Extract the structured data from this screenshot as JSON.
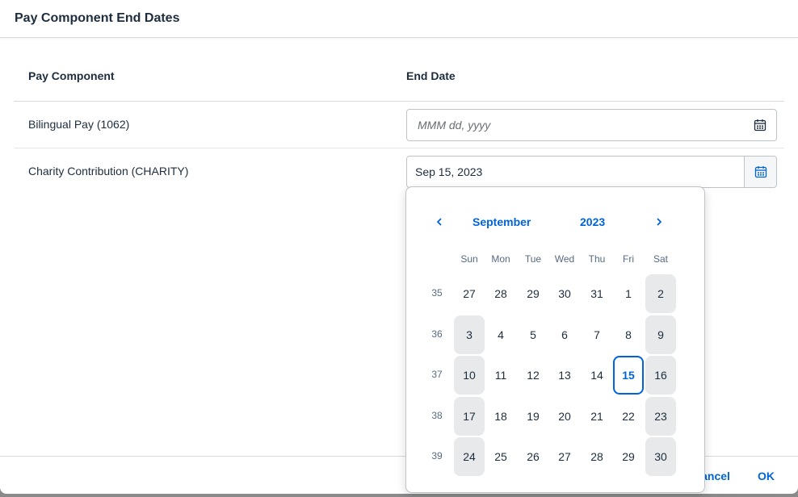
{
  "dialog": {
    "title": "Pay Component End Dates"
  },
  "table": {
    "col_pay_component": "Pay Component",
    "col_end_date": "End Date",
    "rows": [
      {
        "label": "Bilingual Pay (1062)",
        "value": "",
        "placeholder": "MMM dd, yyyy"
      },
      {
        "label": "Charity Contribution (CHARITY)",
        "value": "Sep 15, 2023",
        "placeholder": ""
      }
    ]
  },
  "calendar": {
    "month": "September",
    "year": "2023",
    "weekdays": [
      "Sun",
      "Mon",
      "Tue",
      "Wed",
      "Thu",
      "Fri",
      "Sat"
    ],
    "weeks": [
      {
        "week": "35",
        "days": [
          "27",
          "28",
          "29",
          "30",
          "31",
          "1",
          "2"
        ]
      },
      {
        "week": "36",
        "days": [
          "3",
          "4",
          "5",
          "6",
          "7",
          "8",
          "9"
        ]
      },
      {
        "week": "37",
        "days": [
          "10",
          "11",
          "12",
          "13",
          "14",
          "15",
          "16"
        ]
      },
      {
        "week": "38",
        "days": [
          "17",
          "18",
          "19",
          "20",
          "21",
          "22",
          "23"
        ]
      },
      {
        "week": "39",
        "days": [
          "24",
          "25",
          "26",
          "27",
          "28",
          "29",
          "30"
        ]
      }
    ],
    "selected_day": "15",
    "icons": {
      "prev": "chevron-left-icon",
      "next": "chevron-right-icon",
      "calendar": "calendar-icon"
    },
    "accent_color": "#0064d9"
  },
  "footer": {
    "cancel_label": "Cancel",
    "ok_label": "OK"
  }
}
